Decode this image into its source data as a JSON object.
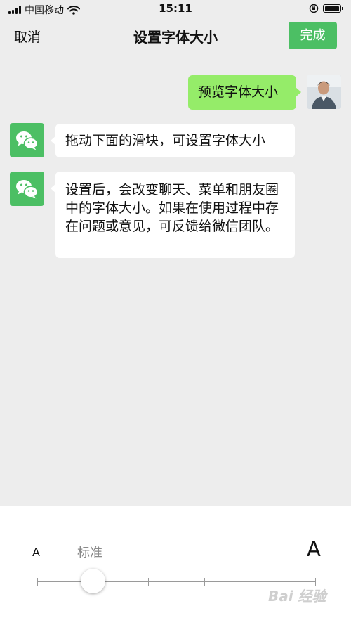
{
  "status_bar": {
    "carrier": "中国移动",
    "time": "15:11",
    "icons": [
      "signal-icon",
      "wifi-icon",
      "orientation-lock-icon",
      "battery-icon"
    ]
  },
  "nav": {
    "cancel_label": "取消",
    "title": "设置字体大小",
    "done_label": "完成",
    "accent_color": "#4cbf64"
  },
  "chat": {
    "outgoing": {
      "text": "预览字体大小",
      "bubble_color": "#95ec69"
    },
    "incoming": [
      {
        "text": "拖动下面的滑块，可设置字体大小"
      },
      {
        "text": "设置后，会改变聊天、菜单和朋友圈中的字体大小。如果在使用过程中存在问题或意见，可反馈给微信团队。"
      }
    ]
  },
  "font_slider": {
    "small_label": "A",
    "large_label": "A",
    "current_label": "标准",
    "steps": 6,
    "selected_step": 1
  },
  "watermark": "Bai 经验"
}
